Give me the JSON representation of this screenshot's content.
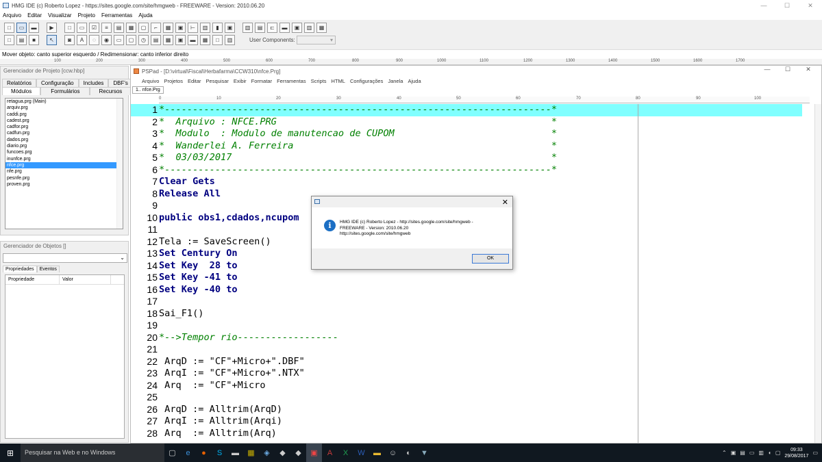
{
  "window": {
    "title": "HMG IDE (c) Roberto Lopez - https://sites.google.com/site/hmgweb - FREEWARE - Version: 2010.06.20",
    "controls": [
      "—",
      "☐",
      "✕"
    ]
  },
  "menubar": [
    "Arquivo",
    "Editar",
    "Visualizar",
    "Projeto",
    "Ferramentas",
    "Ajuda"
  ],
  "toolbar": {
    "user_components_label": "User Components:",
    "user_components_value": "▾"
  },
  "statusline": "Mover objeto: canto superior esquerdo / Redimensionar: canto inferior direito",
  "ruler_top": [
    "100",
    "200",
    "300",
    "400",
    "500",
    "600",
    "700",
    "800",
    "900",
    "1000",
    "1100",
    "1200",
    "1300",
    "1400",
    "1500",
    "1600",
    "1700"
  ],
  "project_manager": {
    "title": "Gerenciador de Projeto [ccw.hbp]",
    "tabs_row1": [
      "Relatórios",
      "Configuração",
      "Includes",
      "DBF's"
    ],
    "tabs_row2": [
      "Módulos",
      "Formulários",
      "Recursos"
    ],
    "files": [
      "retagua.prg (Main)",
      "arquiv.prg",
      "caddi.prg",
      "cadest.prg",
      "cadfor.prg",
      "cadfun.prg",
      "dados.prg",
      "diario.prg",
      "funcoes.prg",
      "inunfce.prg",
      "nfce.prg",
      "nfe.prg",
      "pesnfe.prg",
      "proven.prg"
    ],
    "selected_index": 10
  },
  "object_manager": {
    "title": "Gerenciador de Objetos []",
    "tabs": [
      "Propriedades",
      "Eventos"
    ],
    "columns": [
      "Propriedade",
      "Valor"
    ]
  },
  "pspad": {
    "title": "PSPad - [D:\\virtual\\Fiscal\\Herbafarma\\CCW310\\nfce.Prg]",
    "menu": [
      "Arquivo",
      "Projetos",
      "Editar",
      "Pesquisar",
      "Exibir",
      "Formatar",
      "Ferramentas",
      "Scripts",
      "HTML",
      "Configurações",
      "Janela",
      "Ajuda"
    ],
    "tab": "1.. nfce.Prg",
    "ruler": [
      "0",
      "10",
      "20",
      "30",
      "40",
      "50",
      "60",
      "70",
      "80",
      "90",
      "100"
    ],
    "lines": [
      {
        "n": "1",
        "t": "*---------------------------------------------------------------------*"
      },
      {
        "n": "2",
        "t": "*  Arquivo : NFCE.PRG                                                 *"
      },
      {
        "n": "3",
        "t": "*  Modulo  : Modulo de manutencao de CUPOM                            *"
      },
      {
        "n": "4",
        "t": "*  Wanderlei A. Ferreira                                              *"
      },
      {
        "n": "5",
        "t": "*  03/03/2017                                                         *"
      },
      {
        "n": "6",
        "t": "*---------------------------------------------------------------------*"
      },
      {
        "n": "7",
        "t": "Clear Gets"
      },
      {
        "n": "8",
        "t": "Release All"
      },
      {
        "n": "9",
        "t": ""
      },
      {
        "n": "10",
        "t": "public obs1,cdados,ncupom"
      },
      {
        "n": "11",
        "t": ""
      },
      {
        "n": "12",
        "t": "Tela := SaveScreen()"
      },
      {
        "n": "13",
        "t": "Set Century On"
      },
      {
        "n": "14",
        "t": "Set Key  28 to"
      },
      {
        "n": "15",
        "t": "Set Key -41 to"
      },
      {
        "n": "16",
        "t": "Set Key -40 to"
      },
      {
        "n": "17",
        "t": ""
      },
      {
        "n": "18",
        "t": "Sai_F1()"
      },
      {
        "n": "19",
        "t": ""
      },
      {
        "n": "20",
        "t": "*-->Tempor rio------------------"
      },
      {
        "n": "21",
        "t": ""
      },
      {
        "n": "22",
        "t": " ArqD := \"CF\"+Micro+\".DBF\""
      },
      {
        "n": "23",
        "t": " ArqI := \"CF\"+Micro+\".NTX\""
      },
      {
        "n": "24",
        "t": " Arq  := \"CF\"+Micro"
      },
      {
        "n": "25",
        "t": ""
      },
      {
        "n": "26",
        "t": " ArqD := Alltrim(ArqD)"
      },
      {
        "n": "27",
        "t": " ArqI := Alltrim(Arqi)"
      },
      {
        "n": "28",
        "t": " Arq  := Alltrim(Arq)"
      }
    ]
  },
  "dialog": {
    "text": "HMG IDE (c) Roberto Lopez - http://sites.google.com/site/hmgweb -\nFREEWARE - Version: 2010.06.20\nhttp://sites.google.com/site/hmgweb",
    "ok": "OK",
    "icon": "i"
  },
  "taskbar": {
    "search": "Pesquisar na Web e no Windows",
    "time": "09:33",
    "date": "29/08/2017"
  }
}
